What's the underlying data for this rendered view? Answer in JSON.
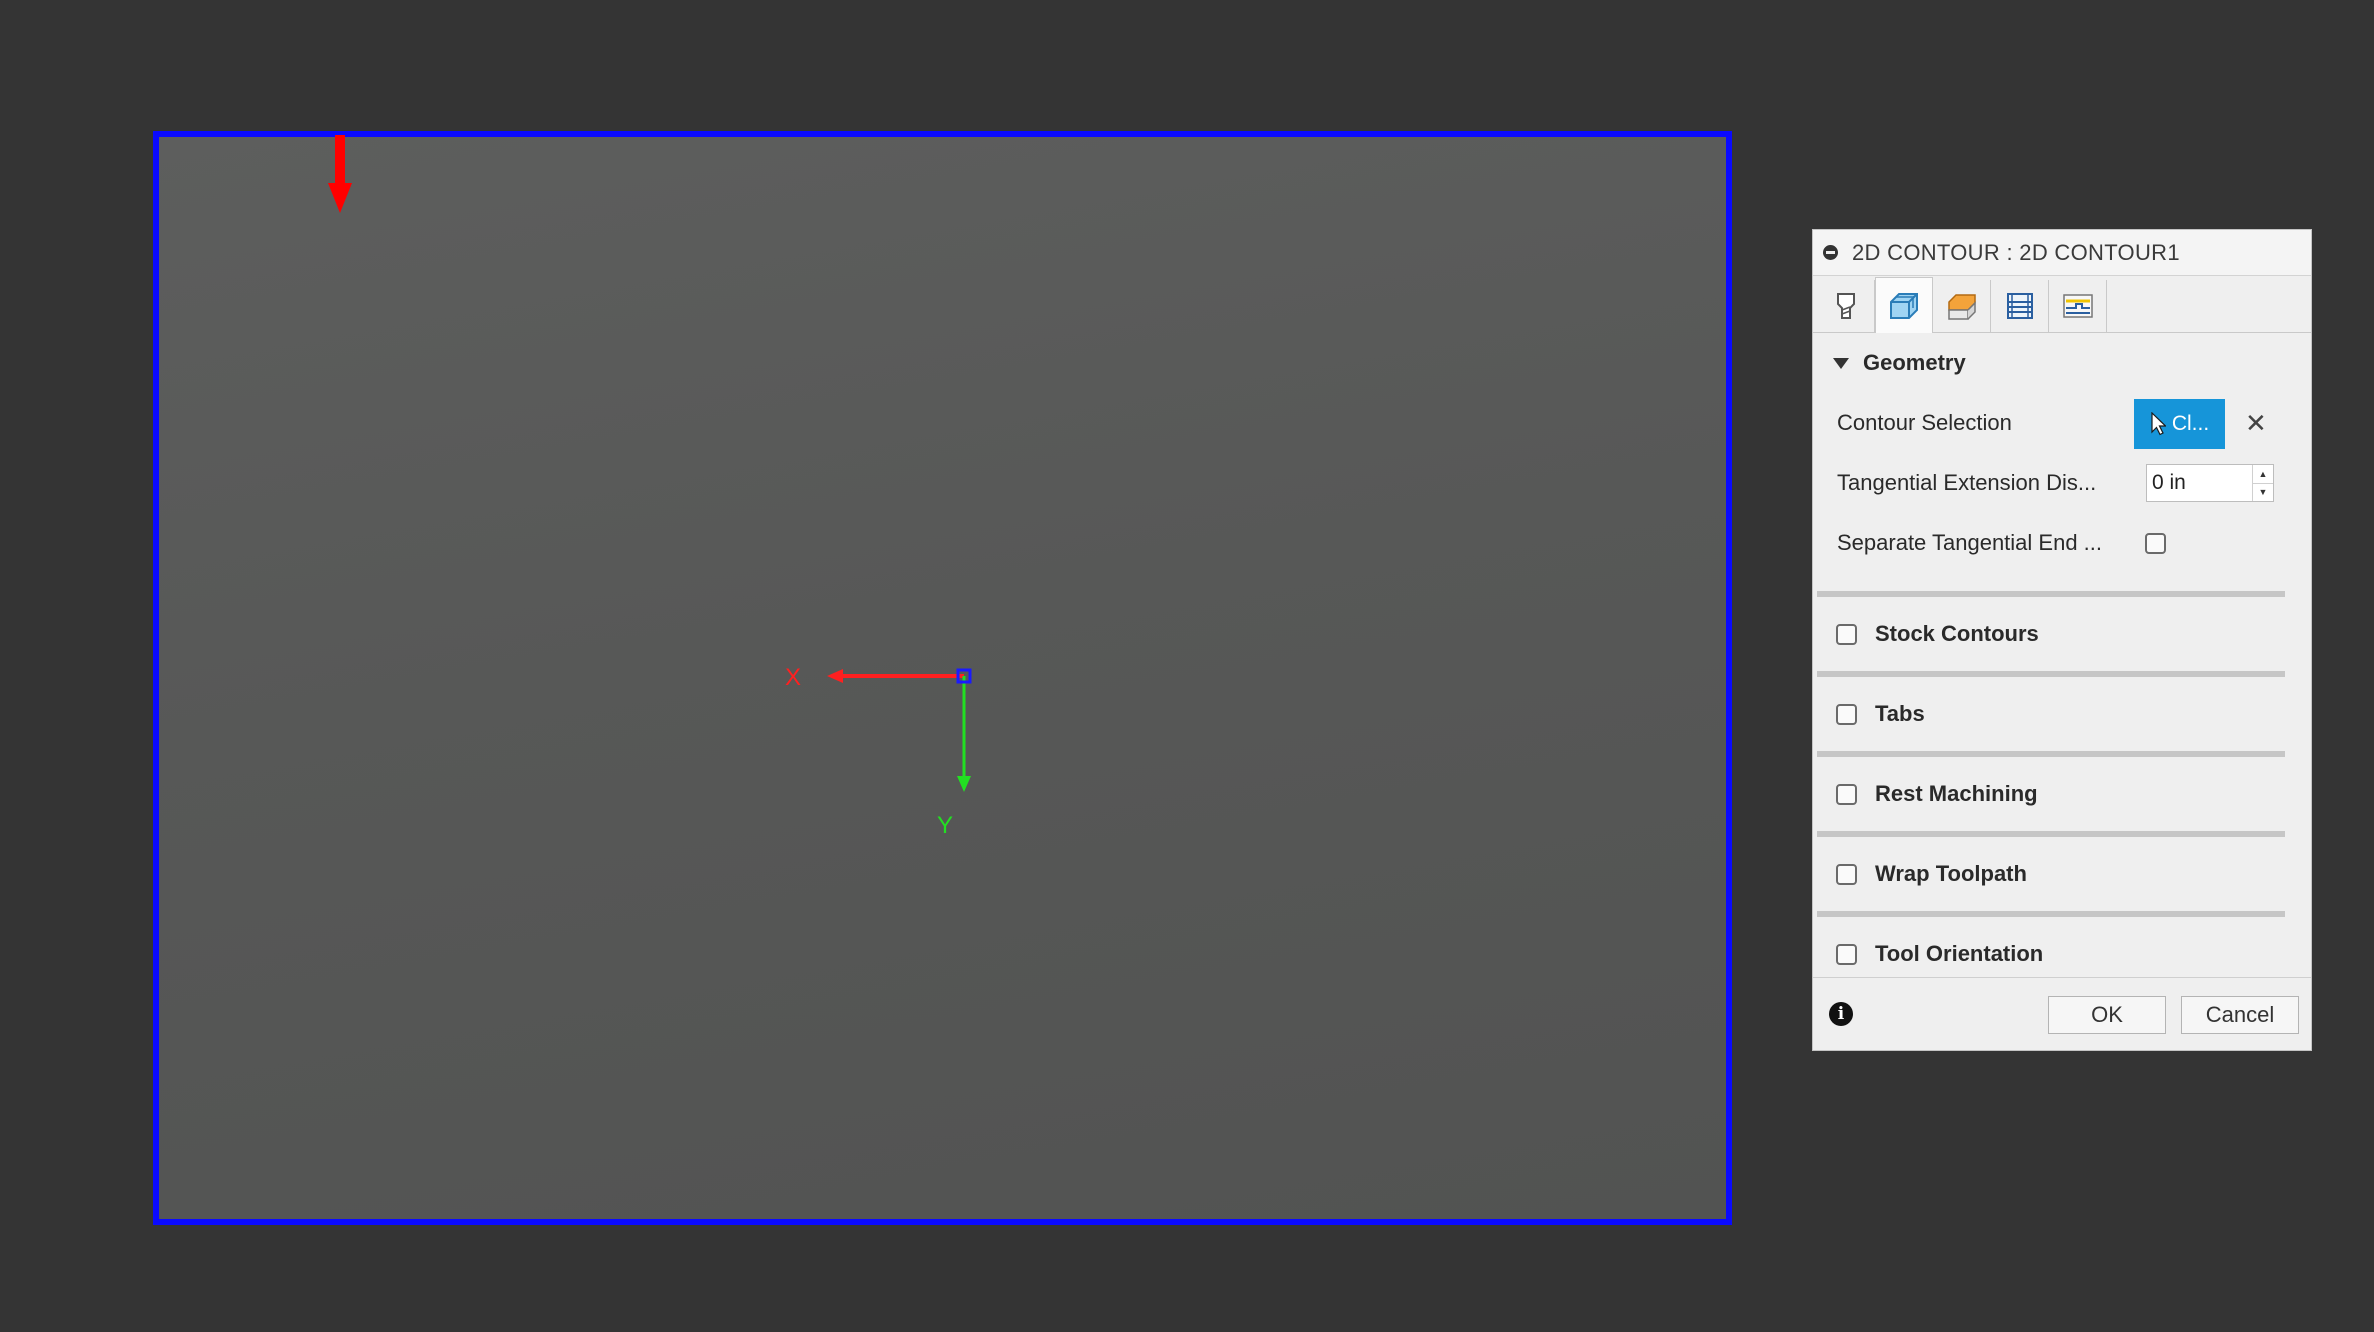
{
  "dialog": {
    "title": "2D CONTOUR : 2D CONTOUR1",
    "tabs": [
      {
        "icon": "tool-icon",
        "active": false
      },
      {
        "icon": "geometry-icon",
        "active": true
      },
      {
        "icon": "heights-icon",
        "active": false
      },
      {
        "icon": "passes-icon",
        "active": false
      },
      {
        "icon": "linking-icon",
        "active": false
      }
    ],
    "geometry": {
      "section_label": "Geometry",
      "contour_selection_label": "Contour Selection",
      "contour_selection_value": "Cl...",
      "tangential_extension_label": "Tangential Extension Dis...",
      "tangential_extension_value": "0 in",
      "separate_tangential_label": "Separate Tangential End ...",
      "separate_tangential_checked": false
    },
    "groups": [
      {
        "label": "Stock Contours",
        "checked": false
      },
      {
        "label": "Tabs",
        "checked": false
      },
      {
        "label": "Rest Machining",
        "checked": false
      },
      {
        "label": "Wrap Toolpath",
        "checked": false
      },
      {
        "label": "Tool Orientation",
        "checked": false
      }
    ],
    "ok_label": "OK",
    "cancel_label": "Cancel"
  },
  "viewport": {
    "axis_x_label": "X",
    "axis_y_label": "Y",
    "border_color": "#0a0aff",
    "stock_arrow_color": "#ff0000"
  },
  "colors": {
    "accent": "#1695d9",
    "x_axis": "#ff2020",
    "y_axis": "#22e022",
    "z_axis": "#1a1aff"
  }
}
